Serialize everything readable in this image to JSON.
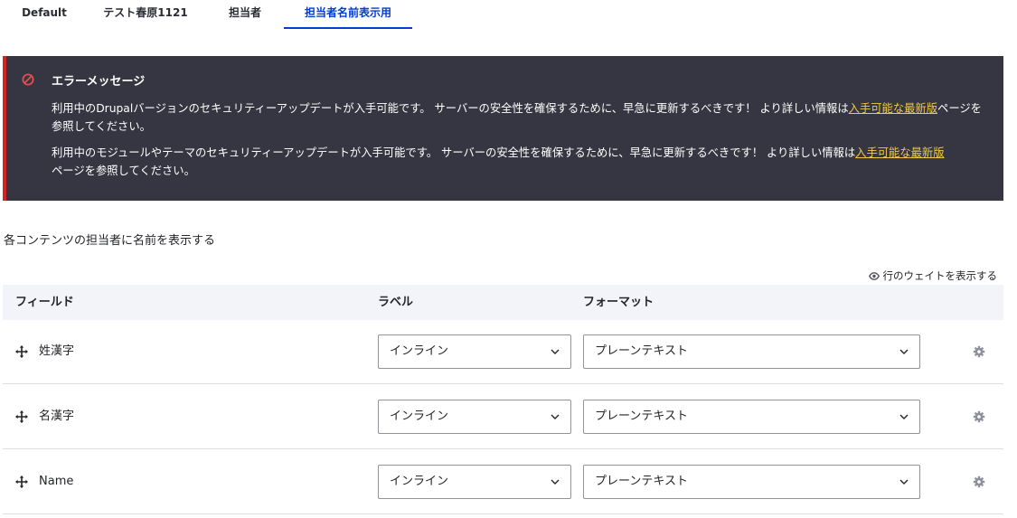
{
  "tabs": [
    {
      "label": "Default"
    },
    {
      "label": "テスト春原1121"
    },
    {
      "label": "担当者"
    },
    {
      "label": "担当者名前表示用"
    }
  ],
  "alert": {
    "title": "エラーメッセージ",
    "messages": [
      {
        "before": "利用中のDrupalバージョンのセキュリティーアップデートが入手可能です。 サーバーの安全性を確保するために、早急に更新するべきです！ より詳しい情報は",
        "link": "入手可能な最新版",
        "after": "ページを参照してください。"
      },
      {
        "before": "利用中のモジュールやテーマのセキュリティーアップデートが入手可能です。 サーバーの安全性を確保するために、早急に更新するべきです！ より詳しい情報は",
        "link": "入手可能な最新版",
        "after": "ページを参照してください。"
      }
    ],
    "colors": {
      "background": "#353641",
      "border": "#d72222",
      "link": "#f2c94c"
    }
  },
  "description": "各コンテンツの担当者に名前を表示する",
  "weights_toggle": "行のウェイトを表示する",
  "table": {
    "headers": {
      "field": "フィールド",
      "label": "ラベル",
      "format": "フォーマット"
    },
    "rows": [
      {
        "field": "姓漢字",
        "label_value": "インライン",
        "format_value": "プレーンテキスト"
      },
      {
        "field": "名漢字",
        "label_value": "インライン",
        "format_value": "プレーンテキスト"
      },
      {
        "field": "Name",
        "label_value": "インライン",
        "format_value": "プレーンテキスト"
      }
    ]
  },
  "icons": {
    "alert": "error-icon",
    "eye": "eye-icon",
    "drag": "drag-handle-icon",
    "chevron": "chevron-down-icon",
    "gear": "gear-icon"
  }
}
